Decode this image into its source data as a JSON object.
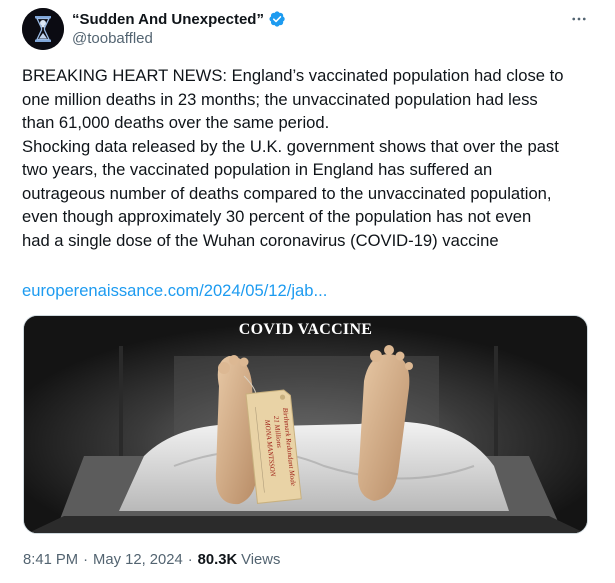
{
  "author": {
    "display_name": "“Sudden And Unexpected”",
    "handle": "@toobaffled",
    "verified": true,
    "avatar_icon": "hourglass-skull-avatar",
    "verified_icon": "verified-badge-icon",
    "verified_color": "#1d9bf0"
  },
  "more_icon": "more-horizontal-icon",
  "tweet": {
    "text": "BREAKING HEART NEWS: England’s vaccinated population had close to\none million deaths in 23 months; the unvaccinated population had less\nthan 61,000 deaths over the same period.\nShocking data released by the U.K. government shows that over the past\ntwo years, the vaccinated population in England has suffered an\noutrageous number of deaths compared to the unvaccinated population,\neven though approximately 30 percent of the population has not even\nhad a single dose of the Wuhan coronavirus (COVID-19) vaccine",
    "link_text": "europerenaissance.com/2024/05/12/jab...",
    "link_color": "#1d9bf0"
  },
  "media": {
    "caption": "COVID VACCINE",
    "tag_lines": [
      "Birthmark Redundant Mode",
      "21 Millions",
      "MONA MANTSSON"
    ]
  },
  "meta": {
    "time": "8:41 PM",
    "date": "May 12, 2024",
    "views_count": "80.3K",
    "views_label": "Views",
    "separator": "·"
  }
}
